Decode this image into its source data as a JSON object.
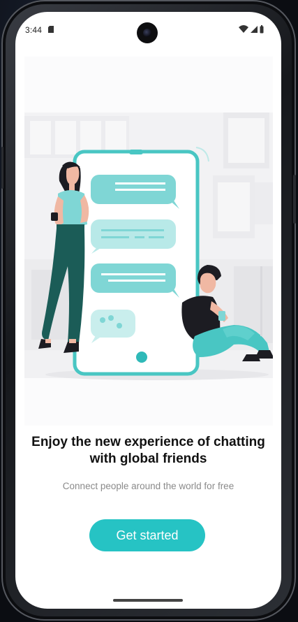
{
  "status_bar": {
    "time": "3:44",
    "icons": [
      "sim-card-icon",
      "wifi-icon",
      "cellular-signal-icon",
      "battery-icon"
    ]
  },
  "onboarding": {
    "illustration": "chat-conversation-illustration",
    "headline_line1": "Enjoy the new experience of chatting",
    "headline_line2": "with global friends",
    "subtitle": "Connect people around the world for free",
    "cta_label": "Get started"
  },
  "colors": {
    "accent": "#26c3c4",
    "bubble": "#7fd6d5",
    "dark_teal": "#1b5c57",
    "background": "#ffffff"
  }
}
